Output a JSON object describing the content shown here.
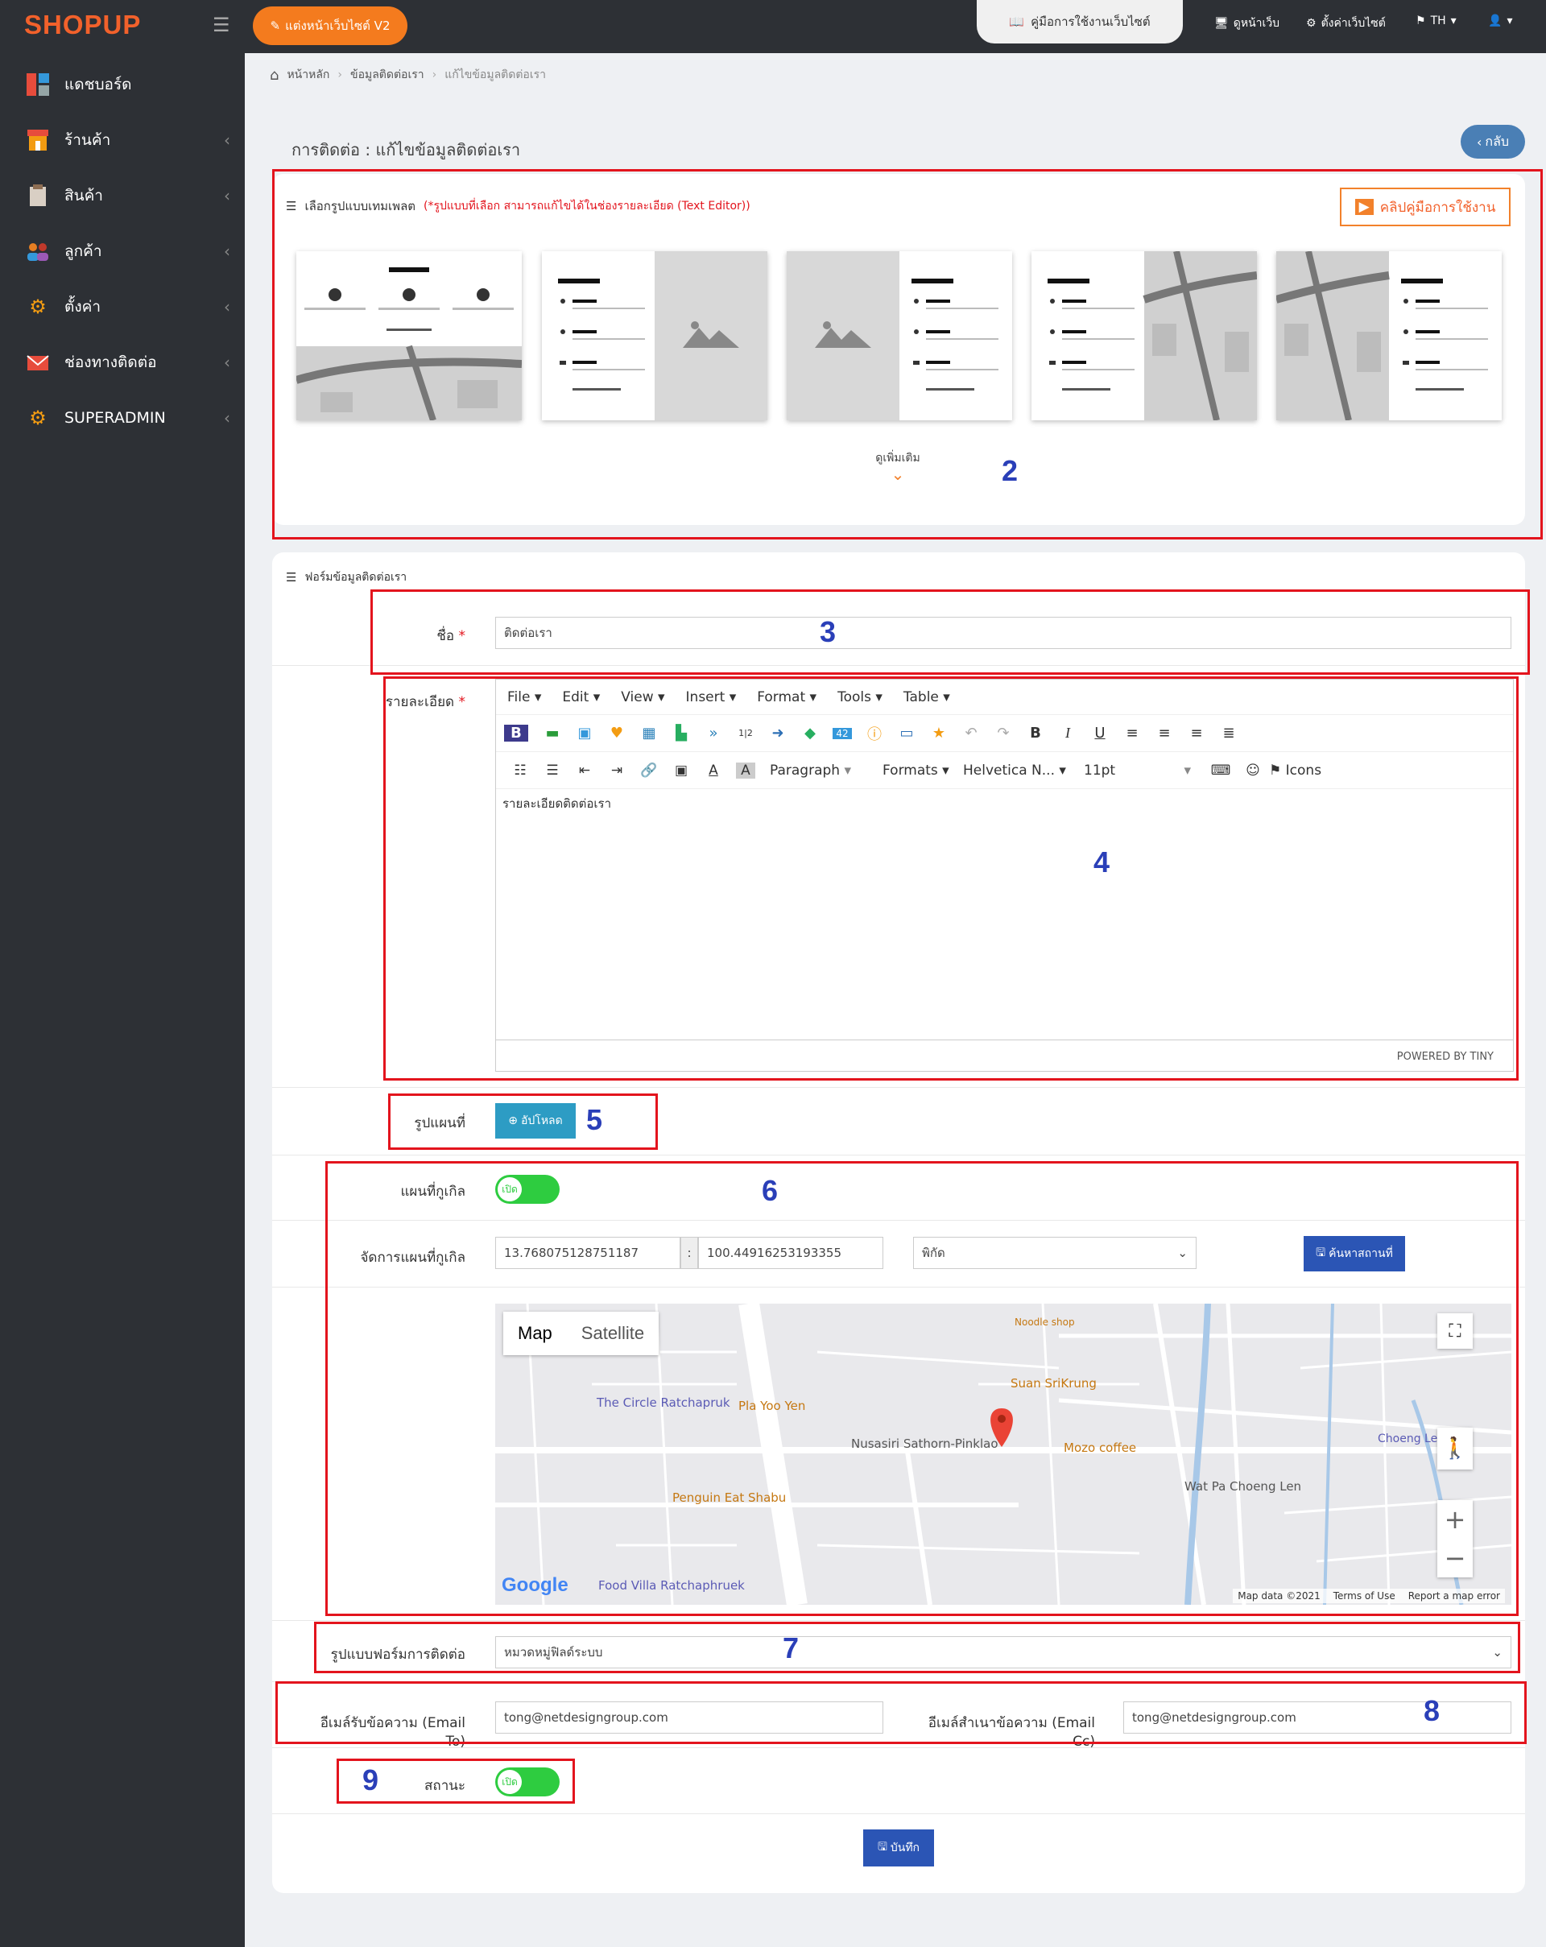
{
  "brand": {
    "logo": "SHOPUP",
    "accent": "#f2612b"
  },
  "topbar": {
    "v2_button": "แต่งหน้าเว็บไซต์ V2",
    "manual_tab": "คู่มือการใช้งานเว็บไซต์",
    "view_site": "ดูหน้าเว็บ",
    "site_settings": "ตั้งค่าเว็บไซต์",
    "language": "TH"
  },
  "sidebar": {
    "items": [
      {
        "label": "แดชบอร์ด",
        "icon": "dashboard-icon",
        "chevron": false
      },
      {
        "label": "ร้านค้า",
        "icon": "store-icon",
        "chevron": true
      },
      {
        "label": "สินค้า",
        "icon": "product-icon",
        "chevron": true
      },
      {
        "label": "ลูกค้า",
        "icon": "customers-icon",
        "chevron": true
      },
      {
        "label": "ตั้งค่า",
        "icon": "gears-icon",
        "chevron": true
      },
      {
        "label": "ช่องทางติดต่อ",
        "icon": "mail-icon",
        "chevron": true
      },
      {
        "label": "SUPERADMIN",
        "icon": "gears-icon",
        "chevron": true
      }
    ]
  },
  "breadcrumb": {
    "home": "หน้าหลัก",
    "section": "ข้อมูลติดต่อเรา",
    "current": "แก้ไขข้อมูลติดต่อเรา"
  },
  "page": {
    "title": "การติดต่อ : แก้ไขข้อมูลติดต่อเรา",
    "back": "กลับ"
  },
  "template_panel": {
    "title": "เลือกรูปแบบเทมเพลต",
    "note": "(*รูปแบบที่เลือก สามารถแก้ไขได้ในช่องรายละเอียด (Text Editor))",
    "clip_button": "คลิปคู่มือการใช้งาน",
    "show_more": "ดูเพิ่มเติม"
  },
  "form": {
    "title": "ฟอร์มข้อมูลติดต่อเรา",
    "name_label": "ชื่อ",
    "name_value": "ติดต่อเรา",
    "detail_label": "รายละเอียด",
    "map_image_label": "รูปแผนที่",
    "upload_button": "อัปโหลด",
    "google_map_label": "แผนที่กูเกิล",
    "toggle_on": "เปิด",
    "manage_map_label": "จัดการแผนที่กูเกิล",
    "lat": "13.768075128751187",
    "colon": ":",
    "lng": "100.44916253193355",
    "coord_select": "พิกัด",
    "search_place": "ค้นหาสถานที่",
    "contact_form_label": "รูปแบบฟอร์มการติดต่อ",
    "contact_form_value": "หมวดหมู่ฟิลด์ระบบ",
    "email_to_label": "อีเมล์รับข้อความ (Email To)",
    "email_to": "tong@netdesigngroup.com",
    "email_cc_label": "อีเมล์สำเนาข้อความ (Email Cc)",
    "email_cc": "tong@netdesigngroup.com",
    "status_label": "สถานะ",
    "save_button": "บันทึก"
  },
  "editor": {
    "menu": [
      "File",
      "Edit",
      "View",
      "Insert",
      "Format",
      "Tools",
      "Table"
    ],
    "paragraph": "Paragraph",
    "formats": "Formats",
    "font": "Helvetica N...",
    "size": "11pt",
    "icons": "Icons",
    "content": "รายละเอียดติดต่อเรา",
    "powered": "POWERED BY TINY"
  },
  "map": {
    "tab_map": "Map",
    "tab_satellite": "Satellite",
    "labels": [
      "The Circle Ratchapruk",
      "Nusasiri Sathorn-Pinklao",
      "Penguin Eat Shabu",
      "Food Villa Ratchaphruek",
      "Pla Yoo Yen",
      "Mozo coffee",
      "Suan SriKrung",
      "Wat Pa Choeng Len",
      "Noodle shop",
      "Choeng Len"
    ],
    "attribution": "Map data ©2021",
    "terms": "Terms of Use",
    "report": "Report a map error",
    "google": "Google"
  },
  "annotations": [
    "2",
    "3",
    "4",
    "5",
    "6",
    "7",
    "8",
    "9"
  ]
}
